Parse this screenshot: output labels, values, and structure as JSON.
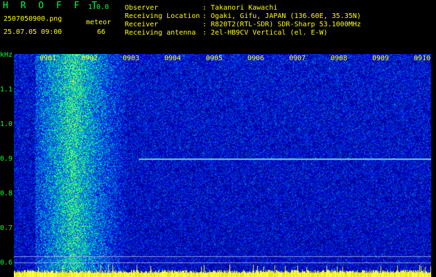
{
  "app": {
    "title": "H R O F F T",
    "version": "1.0.0",
    "filename": "2507050900.png",
    "datetime": "25.07.05 09:00",
    "event_label": "meteor",
    "event_count": "66"
  },
  "info": {
    "rows": [
      {
        "key": "Observer",
        "value": ": Takanori Kawachi"
      },
      {
        "key": "Receiving Location",
        "value": ": Ogaki, Gifu, JAPAN (136.60E, 35.35N)"
      },
      {
        "key": "Receiver",
        "value": ": R820T2(RTL-SDR) SDR-Sharp 53.1000MHz"
      },
      {
        "key": "Receiving antenna",
        "value": ": 2el-HB9CV Vertical (el. E-W)"
      }
    ]
  },
  "axis": {
    "unit": "kHz",
    "y_ticks": [
      "1.1",
      "1.0",
      "0.9",
      "0.8",
      "0.7",
      "0.6"
    ],
    "x_ticks": [
      "0901",
      "0902",
      "0903",
      "0904",
      "0905",
      "0906",
      "0907",
      "0908",
      "0909",
      "0910"
    ]
  },
  "colors": {
    "background": "#000000",
    "label_green": "#00ff40",
    "label_yellow": "#ffff00",
    "spectrum_low": "#000a8c",
    "spectrum_high": "#30ffb0"
  }
}
